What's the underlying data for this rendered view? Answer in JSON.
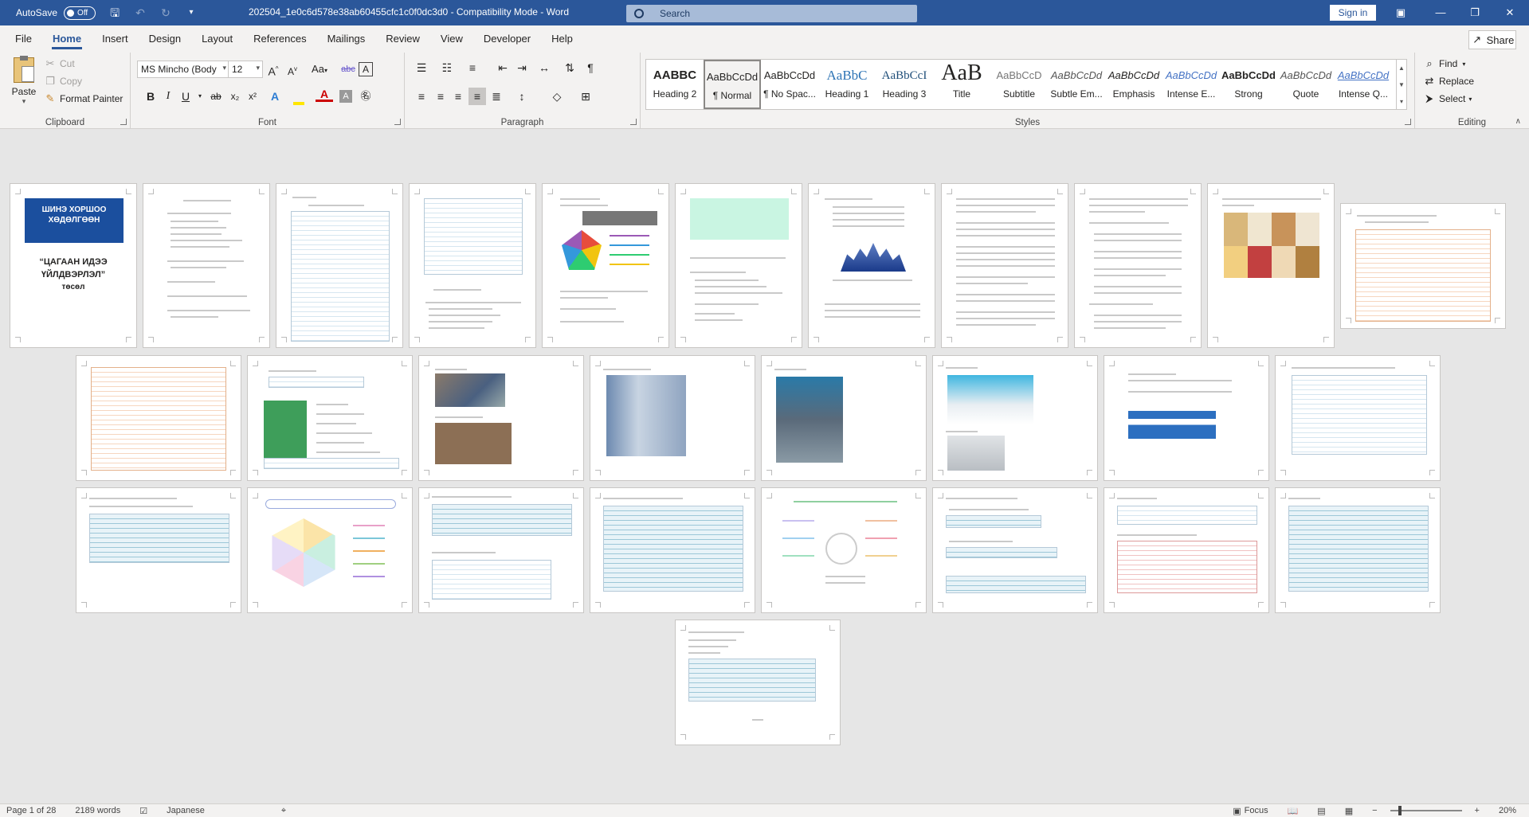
{
  "titlebar": {
    "autosave_label": "AutoSave",
    "autosave_state": "Off",
    "document_title": "202504_1e0c6d578e38ab60455cfc1c0f0dc3d0  -  Compatibility Mode  -  Word",
    "search_placeholder": "Search",
    "signin_label": "Sign in"
  },
  "tabs": [
    "File",
    "Home",
    "Insert",
    "Design",
    "Layout",
    "References",
    "Mailings",
    "Review",
    "View",
    "Developer",
    "Help"
  ],
  "active_tab": "Home",
  "share_label": "Share",
  "clipboard": {
    "paste": "Paste",
    "cut": "Cut",
    "copy": "Copy",
    "format_painter": "Format Painter",
    "label": "Clipboard"
  },
  "font": {
    "name": "MS Mincho (Body",
    "size": "12",
    "label": "Font",
    "case_label": "Aa",
    "bold": "B",
    "italic": "I",
    "underline": "U",
    "strike": "ab",
    "sub": "x₂",
    "sup": "x²"
  },
  "paragraph": {
    "label": "Paragraph"
  },
  "styles": {
    "label": "Styles",
    "items": [
      {
        "sample": "AABBC",
        "name": "Heading 2"
      },
      {
        "sample": "AaBbCcDd",
        "name": "¶ Normal"
      },
      {
        "sample": "AaBbCcDd",
        "name": "¶ No Spac..."
      },
      {
        "sample": "AaBbC",
        "name": "Heading 1"
      },
      {
        "sample": "AaBbCcI",
        "name": "Heading 3"
      },
      {
        "sample": "AaB",
        "name": "Title"
      },
      {
        "sample": "AaBbCcD",
        "name": "Subtitle"
      },
      {
        "sample": "AaBbCcDd",
        "name": "Subtle Em..."
      },
      {
        "sample": "AaBbCcDd",
        "name": "Emphasis"
      },
      {
        "sample": "AaBbCcDd",
        "name": "Intense E..."
      },
      {
        "sample": "AaBbCcDd",
        "name": "Strong"
      },
      {
        "sample": "AaBbCcDd",
        "name": "Quote"
      },
      {
        "sample": "AaBbCcDd",
        "name": "Intense Q..."
      }
    ]
  },
  "editing": {
    "label": "Editing",
    "find": "Find",
    "replace": "Replace",
    "select": "Select"
  },
  "cover": {
    "logo_text": "ШИНЭ ХОРШОО ХӨДӨЛГӨӨН",
    "title_line1": "“ЦАГААН ИДЭЭ",
    "title_line2": "ҮЙЛДВЭРЛЭЛ”",
    "subtitle": "төсөл"
  },
  "colors": {
    "title_bar": "#2b579a",
    "ribbon": "#f3f2f1",
    "canvas": "#e6e6e6",
    "accent": "#2b579a"
  },
  "statusbar": {
    "page": "Page 1 of 28",
    "words": "2189 words",
    "language": "Japanese",
    "focus": "Focus",
    "zoom": "20%"
  }
}
